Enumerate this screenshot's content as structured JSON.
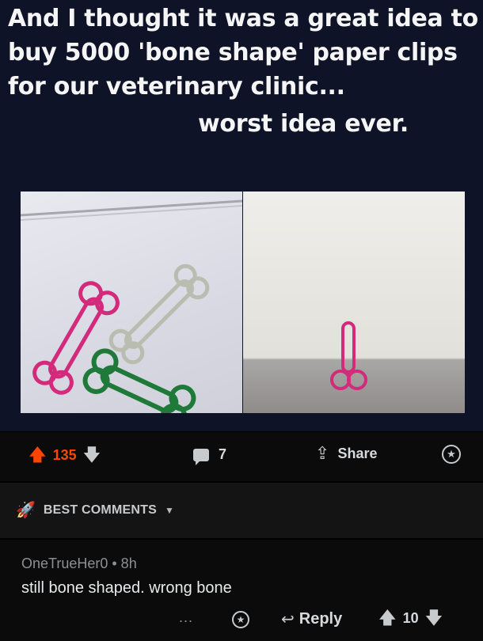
{
  "post": {
    "image": {
      "caption_lines": [
        "And I thought it was a great idea to",
        "buy 5000 'bone shape' paper clips",
        "for our veterinary clinic..."
      ],
      "caption_tail": "worst idea ever.",
      "background_color": "#0e1328"
    },
    "actions": {
      "upvote_icon": "arrow-up-icon",
      "score": "135",
      "downvote_icon": "arrow-down-icon",
      "comment_count": "7",
      "share_label": "Share",
      "award_icon": "award-icon",
      "accent_color": "#ff4500"
    }
  },
  "sort": {
    "icon": "rocket-icon",
    "label": "BEST COMMENTS"
  },
  "comments": [
    {
      "author": "OneTrueHer0",
      "age": "8h",
      "meta": "OneTrueHer0 • 8h",
      "body": "still bone shaped. wrong bone",
      "actions": {
        "more": "...",
        "reply_label": "Reply",
        "score": "10"
      }
    }
  ]
}
